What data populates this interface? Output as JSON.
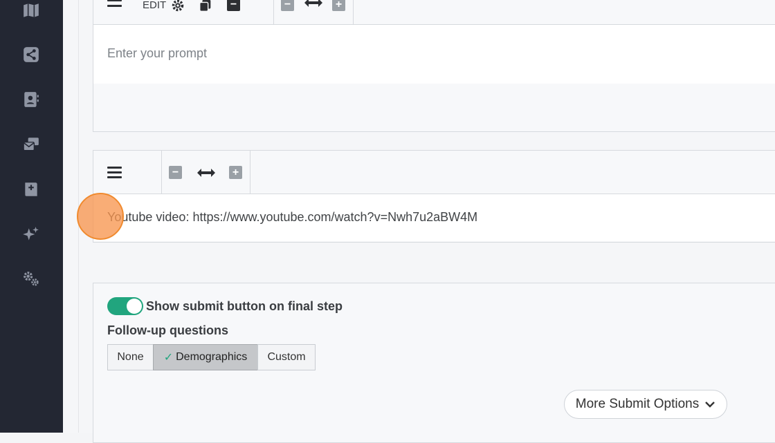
{
  "top_toolbar": {
    "edit_label": "EDIT"
  },
  "prompt_block": {
    "placeholder": "Enter your prompt"
  },
  "video_block": {
    "text": "Youtube video: https://www.youtube.com/watch?v=Nwh7u2aBW4M"
  },
  "submit_section": {
    "toggle_label": "Show submit button on final step",
    "toggle_on": true,
    "followup_title": "Follow-up questions",
    "options": [
      "None",
      "Demographics",
      "Custom"
    ],
    "selected": "Demographics",
    "more_options_label": "More Submit Options"
  },
  "sidebar": {
    "icons": [
      "map-icon",
      "share-icon",
      "contacts-icon",
      "mail-stack-icon",
      "add-book-icon",
      "sparkle-icon",
      "settings-gears-icon"
    ]
  },
  "colors": {
    "sidebar_bg": "#232733",
    "toggle_on": "#21a57e",
    "check": "#21a57e",
    "cursor": "#f7964f"
  }
}
